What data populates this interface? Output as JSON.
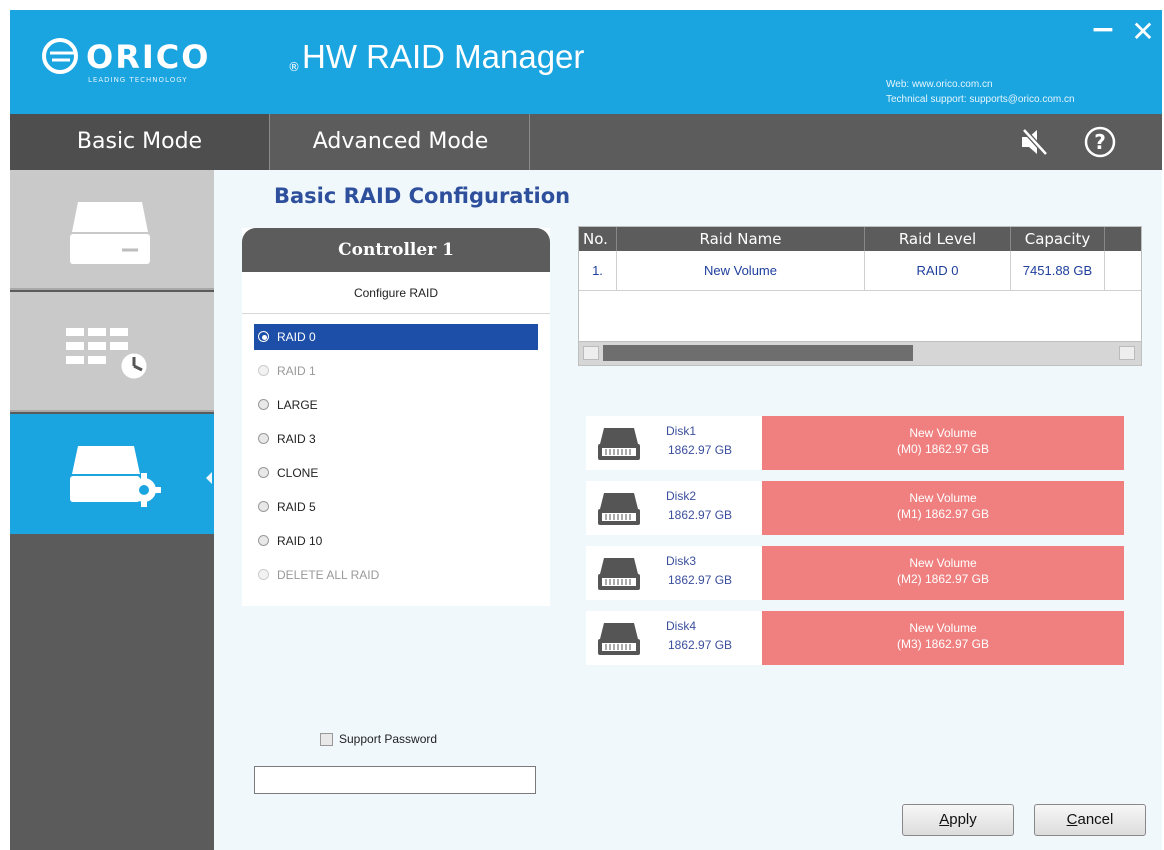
{
  "titlebar": {
    "brand": "ORICO",
    "tagline": "LEADING TECHNOLOGY",
    "registered": "®",
    "app_title": "HW RAID Manager",
    "minimize": "−",
    "close": "✕",
    "web": "Web: www.orico.com.cn",
    "support": "Technical support: supports@orico.com.cn"
  },
  "modes": {
    "basic": "Basic Mode",
    "advanced": "Advanced Mode",
    "active": "Basic Mode"
  },
  "sidebar": {
    "items": [
      {
        "icon": "disk-drive-icon",
        "active": false
      },
      {
        "icon": "table-clock-icon",
        "active": false
      },
      {
        "icon": "disk-settings-icon",
        "active": true
      }
    ]
  },
  "main": {
    "title": "Basic RAID Configuration",
    "controller": "Controller 1",
    "configure_label": "Configure RAID",
    "raid_options": [
      {
        "label": "RAID 0",
        "state": "selected"
      },
      {
        "label": "RAID 1",
        "state": "disabled"
      },
      {
        "label": "LARGE",
        "state": "normal"
      },
      {
        "label": "RAID 3",
        "state": "normal"
      },
      {
        "label": "CLONE",
        "state": "normal"
      },
      {
        "label": "RAID 5",
        "state": "normal"
      },
      {
        "label": "RAID 10",
        "state": "normal"
      },
      {
        "label": "DELETE ALL RAID",
        "state": "disabled"
      }
    ]
  },
  "volume_table": {
    "headers": [
      "No.",
      "Raid Name",
      "Raid Level",
      "Capacity"
    ],
    "rows": [
      {
        "no": "1.",
        "name": "New Volume",
        "level": "RAID 0",
        "capacity": "7451.88 GB"
      }
    ]
  },
  "disks": [
    {
      "name": "Disk1",
      "capacity": "1862.97 GB",
      "volume": "New Volume",
      "member": "(M0) 1862.97 GB"
    },
    {
      "name": "Disk2",
      "capacity": "1862.97 GB",
      "volume": "New Volume",
      "member": "(M1) 1862.97 GB"
    },
    {
      "name": "Disk3",
      "capacity": "1862.97 GB",
      "volume": "New Volume",
      "member": "(M2) 1862.97 GB"
    },
    {
      "name": "Disk4",
      "capacity": "1862.97 GB",
      "volume": "New Volume",
      "member": "(M3) 1862.97 GB"
    }
  ],
  "password": {
    "label": "Support Password",
    "checked": false,
    "value": ""
  },
  "buttons": {
    "apply_prefix": "",
    "apply_hotkey": "A",
    "apply_rest": "pply",
    "cancel_prefix": "",
    "cancel_hotkey": "C",
    "cancel_rest": "ancel"
  },
  "colors": {
    "accent": "#1aa4e0",
    "header_dark": "#5c5c5c",
    "title_blue": "#2d4f9c",
    "selected_blue": "#1e4fa8",
    "volume_red": "#f08080"
  }
}
